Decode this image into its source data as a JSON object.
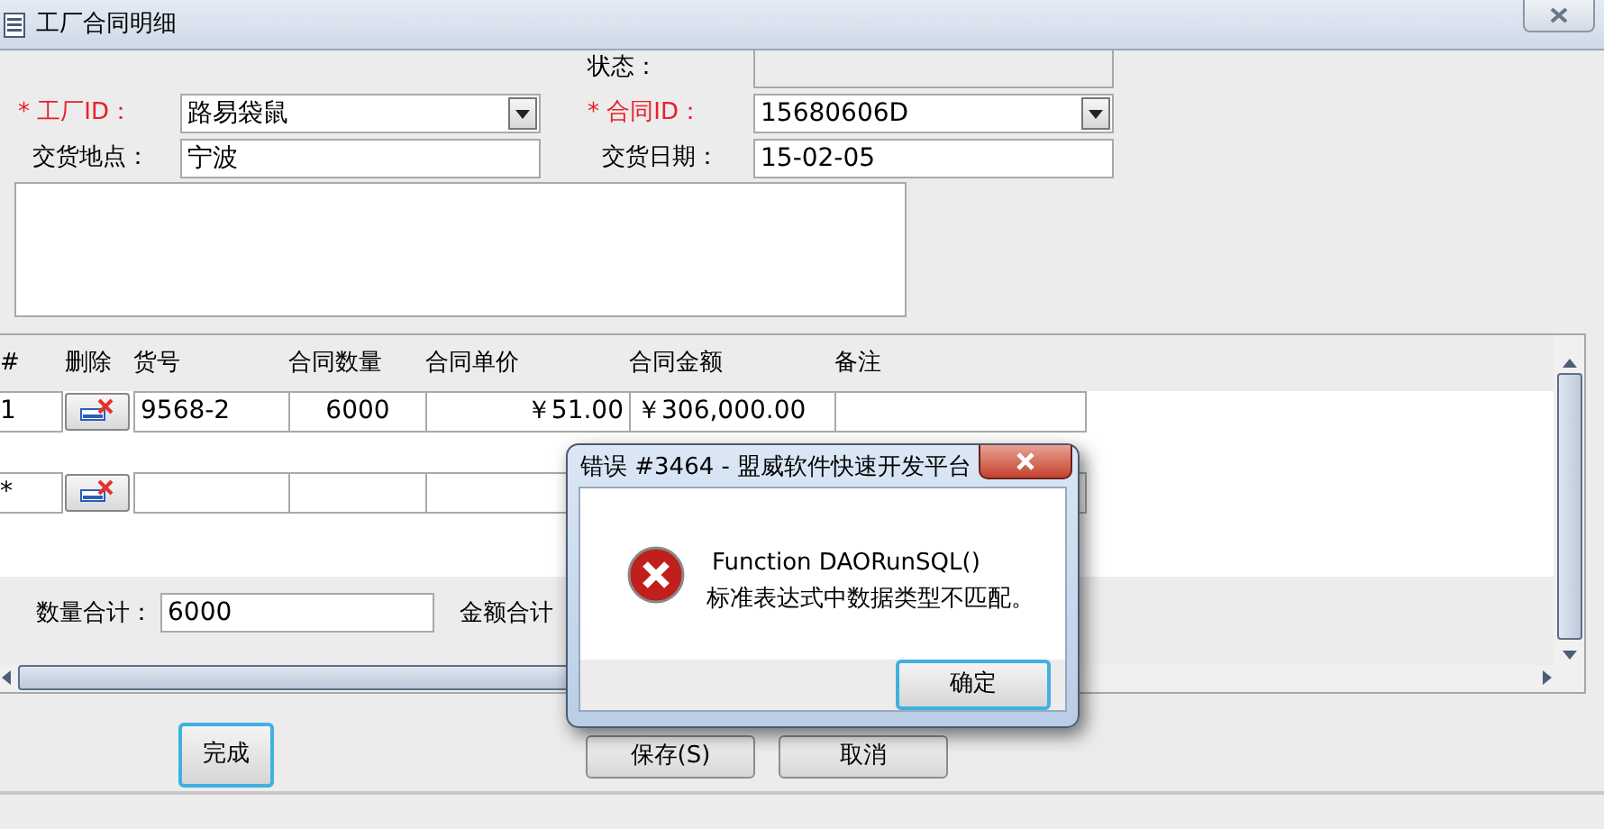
{
  "window": {
    "title": "工厂合同明细"
  },
  "status": {
    "label": "状态："
  },
  "fields": [
    {
      "label": "* 工厂ID：",
      "required": true,
      "kind": "combo",
      "value": "路易袋鼠"
    },
    {
      "label": "* 合同ID：",
      "required": true,
      "kind": "combo",
      "value": "15680606D"
    },
    {
      "label": "交货地点：",
      "required": false,
      "kind": "text",
      "value": "宁波"
    },
    {
      "label": "交货日期：",
      "required": false,
      "kind": "text",
      "value": "15-02-05"
    }
  ],
  "subform": {
    "columns": [
      "#",
      "删除",
      "货号",
      "合同数量",
      "合同单价",
      "合同金额",
      "备注"
    ],
    "rows": [
      {
        "marker": "1",
        "item_no": "9568-2",
        "quantity": "6000",
        "unit_price": "￥51.00",
        "amount": "￥306,000.00"
      },
      {
        "marker": "*"
      }
    ],
    "totals": {
      "quantity_label": "数量合计：",
      "quantity": "6000",
      "amount_label": "金额合计"
    }
  },
  "buttons": [
    {
      "label": "完成",
      "focused": true
    },
    {
      "label": "保存(S)",
      "focused": false
    },
    {
      "label": "取消",
      "focused": false
    }
  ],
  "dialog": {
    "title": "错误 #3464 - 盟威软件快速开发平台",
    "message": [
      "Function DAORunSQL()",
      "标准表达式中数据类型不匹配。"
    ],
    "buttons": [
      {
        "label": "确定",
        "focused": true
      }
    ]
  }
}
